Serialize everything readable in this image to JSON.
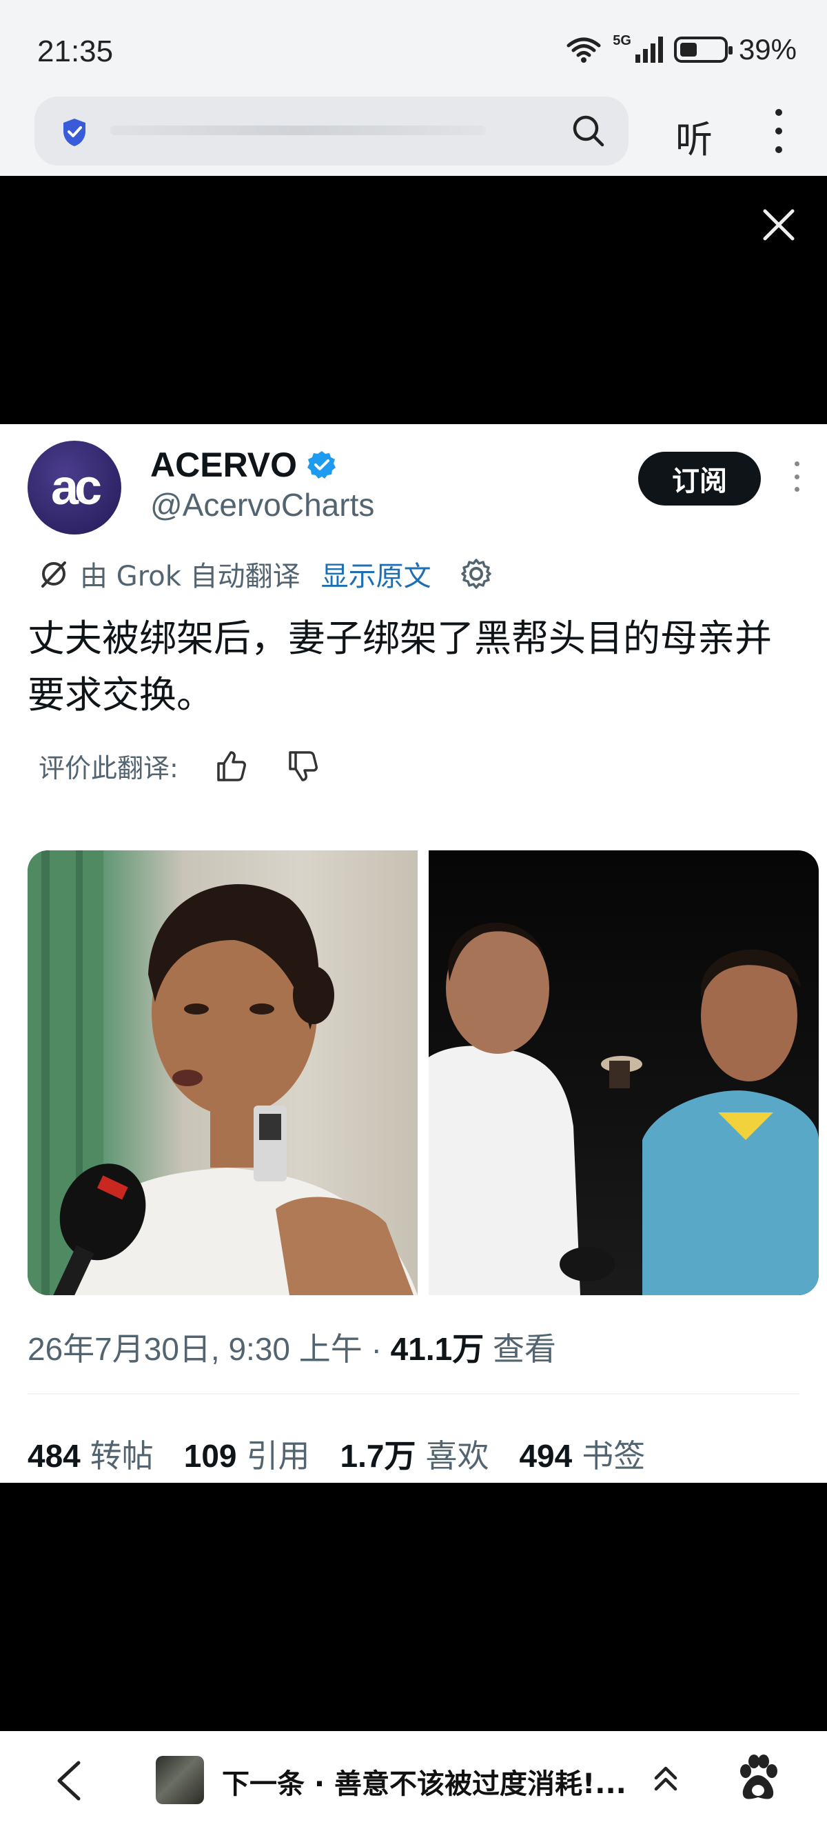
{
  "status_bar": {
    "time": "21:35",
    "network": "5G",
    "battery": "39%"
  },
  "browser": {
    "listen_label": "听"
  },
  "tweet": {
    "display_name": "ACERVO",
    "handle": "@AcervoCharts",
    "avatar_text": "ac",
    "subscribe_label": "订阅",
    "translated_by": "由 Grok 自动翻译",
    "show_original": "显示原文",
    "text": "丈夫被绑架后，妻子绑架了黑帮头目的母亲并要求交换。",
    "rate_translation": "评价此翻译:",
    "date": "26年7月30日, 9:30 上午 · ",
    "views_count": "41.1万",
    "views_label": " 查看",
    "stats": [
      {
        "count": "484",
        "label": "转帖"
      },
      {
        "count": "109",
        "label": "引用"
      },
      {
        "count": "1.7万",
        "label": "喜欢"
      },
      {
        "count": "494",
        "label": "书签"
      }
    ]
  },
  "bottom_nav": {
    "next_title": "下一条 · 善意不该被过度消耗!..."
  },
  "colors": {
    "brand_avatar": "#2d2266",
    "link": "#1d6fb3",
    "verified": "#1d9bf0",
    "text_primary": "#0f1419",
    "text_secondary": "#536471"
  }
}
